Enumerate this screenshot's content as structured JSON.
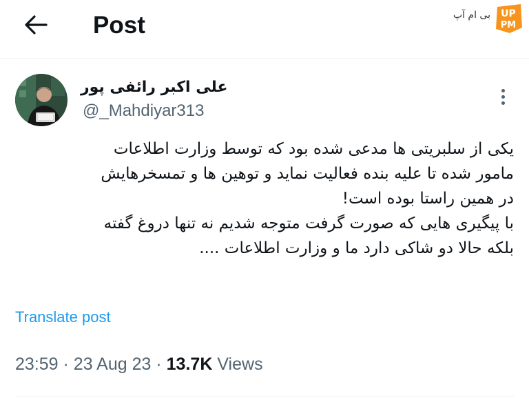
{
  "header": {
    "back_icon": "arrow-left-icon",
    "title": "Post",
    "watermark_text": "بی ام آپ",
    "watermark_logo_text": "UP PM",
    "watermark_accent": "#f7941d"
  },
  "tweet": {
    "author_name": "علی اکبر رائفی پور",
    "author_handle": "@_Mahdiyar313",
    "more_icon": "more-vertical-icon",
    "text_lines": [
      "یکی از سلبریتی ها مدعی شده بود که توسط وزارت اطلاعات",
      "مامور شده تا علیه بنده فعالیت نماید و  توهین ها و تمسخرهایش",
      "در همین راستا بوده است!",
      "با پیگیری هایی که صورت گرفت متوجه شدیم نه تنها دروغ گفته",
      "بلکه حالا دو شاکی دارد ما و وزارت اطلاعات ...."
    ],
    "translate_label": "Translate post",
    "time": "23:59",
    "separator": "·",
    "date": "23 Aug 23",
    "views_count": "13.7K",
    "views_label": "Views"
  },
  "colors": {
    "link": "#1d9bf0",
    "secondary_text": "#536471",
    "primary_text": "#0f1419"
  }
}
